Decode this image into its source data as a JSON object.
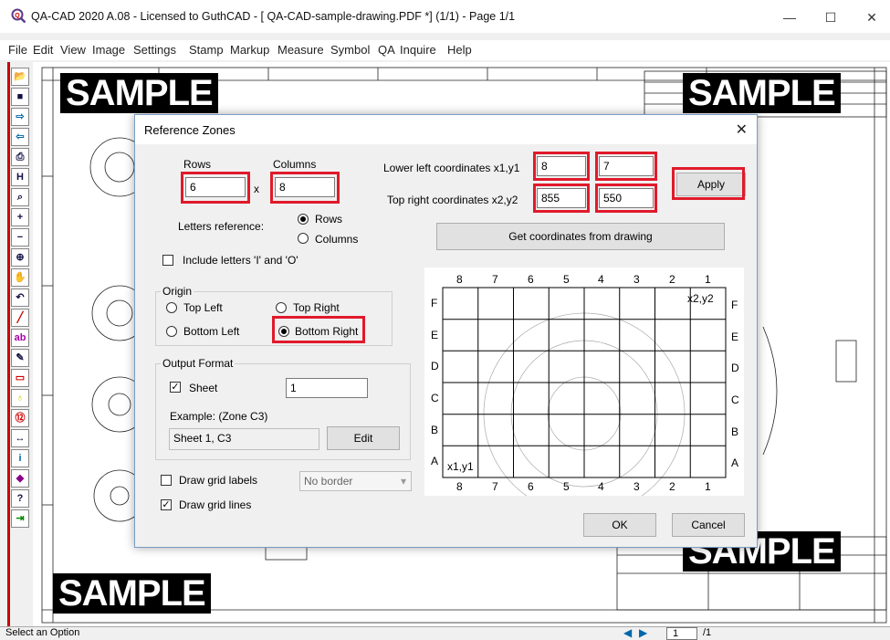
{
  "window": {
    "title": "QA-CAD 2020 A.08 - Licensed to GuthCAD  -  [ QA-CAD-sample-drawing.PDF *] (1/1)  -  Page 1/1",
    "minimize": "—",
    "maximize": "☐",
    "close": "✕"
  },
  "menu": [
    "File",
    "Edit",
    "View",
    "Image",
    "Settings",
    "Stamp",
    "Markup",
    "Measure",
    "Symbol",
    "QA",
    "Inquire",
    "Help"
  ],
  "canvas": {
    "watermark": "SAMPLE"
  },
  "dialog": {
    "title": "Reference Zones",
    "close": "✕",
    "rows_label": "Rows",
    "columns_label": "Columns",
    "rows_value": "6",
    "times": "x",
    "columns_value": "8",
    "letters_reference": "Letters reference:",
    "letters_options": [
      "Rows",
      "Columns"
    ],
    "letters_selected": "Rows",
    "include_io": "Include letters 'I' and 'O'",
    "lower_left_label": "Lower left coordinates  x1,y1",
    "x1": "8",
    "y1": "7",
    "top_right_label": "Top right coordinates  x2,y2",
    "x2": "855",
    "y2": "550",
    "apply": "Apply",
    "get_coords": "Get coordinates from drawing",
    "origin_title": "Origin",
    "origin_options": [
      "Top Left",
      "Top Right",
      "Bottom Left",
      "Bottom Right"
    ],
    "origin_selected": "Bottom Right",
    "output_title": "Output Format",
    "sheet_label": "Sheet",
    "sheet_checked": true,
    "sheet_value": "1",
    "example_label": "Example:  (Zone C3)",
    "example_value": "Sheet 1, C3",
    "edit": "Edit",
    "draw_labels": "Draw grid labels",
    "draw_labels_checked": false,
    "border_select": "No border",
    "draw_lines": "Draw grid lines",
    "draw_lines_checked": true,
    "ok": "OK",
    "cancel": "Cancel",
    "preview": {
      "col_labels": [
        "8",
        "7",
        "6",
        "5",
        "4",
        "3",
        "2",
        "1"
      ],
      "row_labels": [
        "F",
        "E",
        "D",
        "C",
        "B",
        "A"
      ],
      "corner_tr": "x2,y2",
      "corner_bl": "x1,y1"
    }
  },
  "status": {
    "message": "Select an Option",
    "page": "1",
    "page_of": "/1"
  }
}
